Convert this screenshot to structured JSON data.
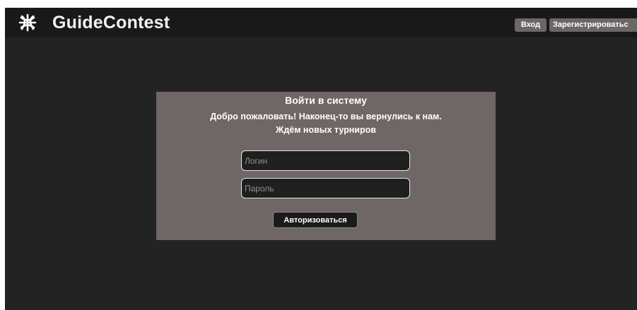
{
  "header": {
    "brand": "GuideContest",
    "logo_icon": "basketball-icon",
    "login_label": "Вход",
    "register_label": "Зарегистрироватьс"
  },
  "login_panel": {
    "title": "Войти в систему",
    "welcome_line1": "Добро пожаловать! Наконец-то вы вернулись к нам.",
    "welcome_line2": "Ждём новых турниров",
    "login_placeholder": "Логин",
    "password_placeholder": "Пароль",
    "submit_label": "Авторизоваться"
  },
  "colors": {
    "page_bg": "#232323",
    "header_bg": "#191919",
    "panel_bg": "#6e6766",
    "button_bg": "#6b6766",
    "input_bg": "#1f1f1f"
  }
}
